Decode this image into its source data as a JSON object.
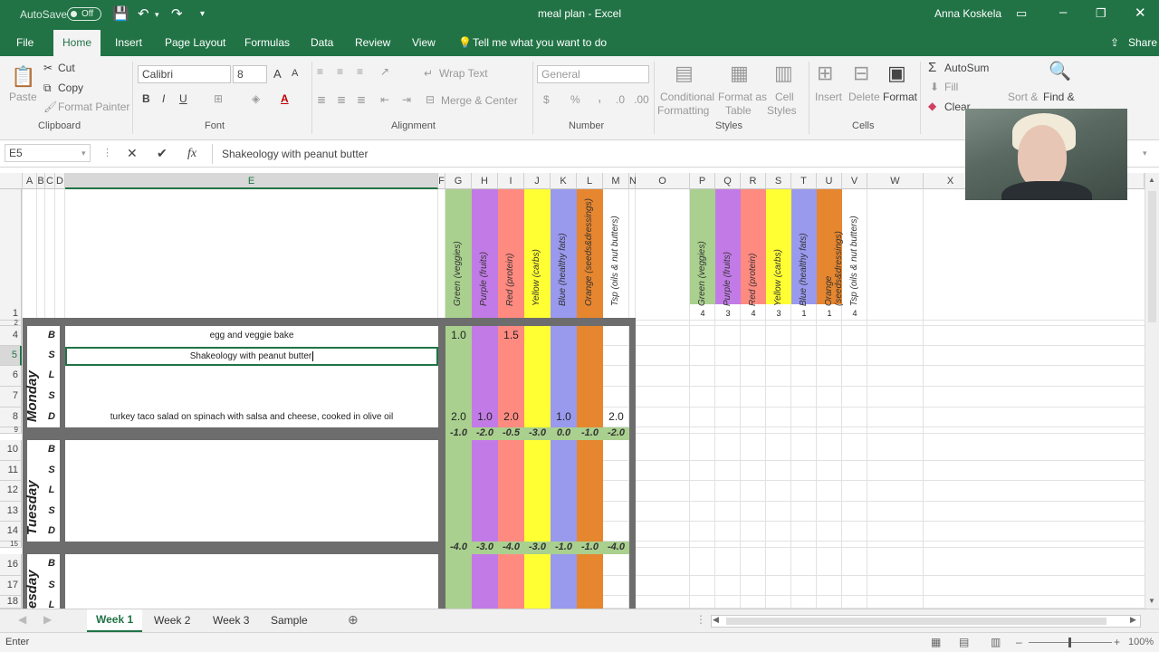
{
  "titlebar": {
    "autosave": "AutoSave",
    "autosave_state": "Off",
    "title": "meal plan  -  Excel",
    "user": "Anna Koskela"
  },
  "menu": [
    "File",
    "Home",
    "Insert",
    "Page Layout",
    "Formulas",
    "Data",
    "Review",
    "View"
  ],
  "menu_active": "Home",
  "tell_me": "Tell me what you want to do",
  "share": "Share",
  "ribbon": {
    "paste": "Paste",
    "cut": "Cut",
    "copy": "Copy",
    "format_painter": "Format Painter",
    "clipboard": "Clipboard",
    "font_name": "Calibri",
    "font_size": "8",
    "font": "Font",
    "wrap_text": "Wrap Text",
    "merge_center": "Merge & Center",
    "alignment": "Alignment",
    "number_format": "General",
    "number": "Number",
    "cond_format": "Conditional",
    "cond_format2": "Formatting",
    "format_table": "Format as",
    "format_table2": "Table",
    "cell_styles": "Cell",
    "cell_styles2": "Styles",
    "styles": "Styles",
    "insert": "Insert",
    "delete": "Delete",
    "format": "Format",
    "cells": "Cells",
    "autosum": "AutoSum",
    "fill": "Fill",
    "clear": "Clear",
    "sort": "Sort &",
    "find": "Find &"
  },
  "formula": {
    "namebox": "E5",
    "content": "Shakeology with peanut butter"
  },
  "columns": [
    "A",
    "B",
    "C",
    "D",
    "E",
    "F",
    "G",
    "H",
    "I",
    "J",
    "K",
    "L",
    "M",
    "N",
    "O",
    "P",
    "Q",
    "R",
    "S",
    "T",
    "U",
    "V",
    "W",
    "X"
  ],
  "categories": [
    "Green (veggies)",
    "Purple (fruits)",
    "Red (protein)",
    "Yellow (carbs)",
    "Blue (healthy fats)",
    "Orange (seeds&dressings)",
    "Tsp (oils & nut butters)"
  ],
  "targets": [
    "4",
    "3",
    "4",
    "3",
    "1",
    "1",
    "4"
  ],
  "colors": {
    "green": "#a9d08e",
    "purple": "#c27be6",
    "red": "#ff8a80",
    "yellow": "#ffff33",
    "blue": "#9999ee",
    "orange": "#e6862f",
    "excel": "#217346"
  },
  "rows": [
    "1",
    "2",
    "4",
    "5",
    "6",
    "7",
    "8",
    "9",
    "10",
    "11",
    "12",
    "13",
    "14",
    "15",
    "16",
    "17",
    "18"
  ],
  "days": [
    "Monday",
    "Tuesday",
    "esday"
  ],
  "meals": [
    "B",
    "S",
    "L",
    "S",
    "D"
  ],
  "monday": {
    "b_food": "egg and veggie bake",
    "b_vals": [
      "1.0",
      "",
      "1.5"
    ],
    "s_food": "Shakeology with peanut butter",
    "d_food": "turkey taco salad on spinach with salsa and cheese, cooked in olive oil",
    "d_vals": [
      "2.0",
      "1.0",
      "2.0",
      "",
      "1.0",
      "",
      "2.0"
    ],
    "sums": [
      "-1.0",
      "-2.0",
      "-0.5",
      "-3.0",
      "0.0",
      "-1.0",
      "-2.0"
    ]
  },
  "tuesday": {
    "sums": [
      "-4.0",
      "-3.0",
      "-4.0",
      "-3.0",
      "-1.0",
      "-1.0",
      "-4.0"
    ]
  },
  "sheets": [
    "Week 1",
    "Week 2",
    "Week 3",
    "Sample"
  ],
  "active_sheet": "Week 1",
  "status": "Enter",
  "zoom": "100%"
}
